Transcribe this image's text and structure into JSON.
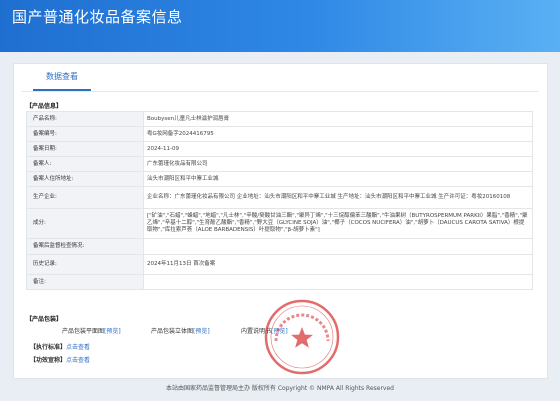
{
  "header": {
    "title": "国产普通化妆品备案信息"
  },
  "tabs": {
    "active": "数据查看"
  },
  "product_info": {
    "section_label": "【产品信息】",
    "rows": [
      {
        "label": "产品名称:",
        "value": "Boubysen儿童凡士林滋护润唇膏"
      },
      {
        "label": "备案编号:",
        "value": "粤G妆网备字2024416795"
      },
      {
        "label": "备案日期:",
        "value": "2024-11-09"
      },
      {
        "label": "备案人:",
        "value": "广东蕾瑾化妆品有限公司"
      },
      {
        "label": "备案人住所地址:",
        "value": "汕头市潮阳区和平中寨工业城"
      },
      {
        "label": "生产企业:",
        "value": "企业名称：广东蕾瑾化妆品有限公司 企业地址：汕头市潮阳区和平中寨工业城 生产地址：汕头市潮阳区和平中寨工业城 生产许可证：粤妆20160108"
      },
      {
        "label": "成分:",
        "value": "[\"矿油\",\"石蜡\",\"蜂蜡\",\"地蜡\",\"凡士林\",\"辛酸/癸酸甘油三酯\",\"聚异丁烯\",\"十三烷醇偏苯三酸酯\",\"牛油果树（BUTYROSPERMUM PARKII）果脂\",\"香精\",\"聚乙烯\",\"辛基十二醇\",\"生育酚乙酸酯\",\"香精\",\"野大豆（GLYCINE SOJA）油\",\"椰子（COCOS NUCIFERA）油\",\"胡萝卜（DAUCUS CAROTA SATIVA）根提取物\",\"库拉索芦荟（ALOE BARBADENSIS）叶提取物\",\"β-胡萝卜素\"]"
      },
      {
        "label": "备案后监督检查情况:",
        "value": ""
      },
      {
        "label": "历史记录:",
        "value": "2024年11月13日 首次备案"
      },
      {
        "label": "备注:",
        "value": ""
      }
    ]
  },
  "packaging": {
    "section_label": "【产品包装】",
    "flat_label": "产品包装平面图",
    "flat_link": "[预览]",
    "solid_label": "产品包装立体图",
    "solid_link": "[预览]",
    "manual_label": "内置说明书",
    "manual_link": "[预览]"
  },
  "standard": {
    "label": "【执行标准】",
    "link": "点击查看"
  },
  "efficacy": {
    "label": "【功效宣称】",
    "link": "点击查看"
  },
  "footer": {
    "text": "本站由国家药品监督管理局主办 版权所有 Copyright © NMPA All Rights Reserved"
  },
  "stamp": {
    "text": "广东蕾瑾化妆品有限公司"
  },
  "colors": {
    "accent": "#2c6fc6",
    "header_start": "#1f6fd0",
    "header_end": "#5ab0f3",
    "stamp": "#d93a3a"
  }
}
